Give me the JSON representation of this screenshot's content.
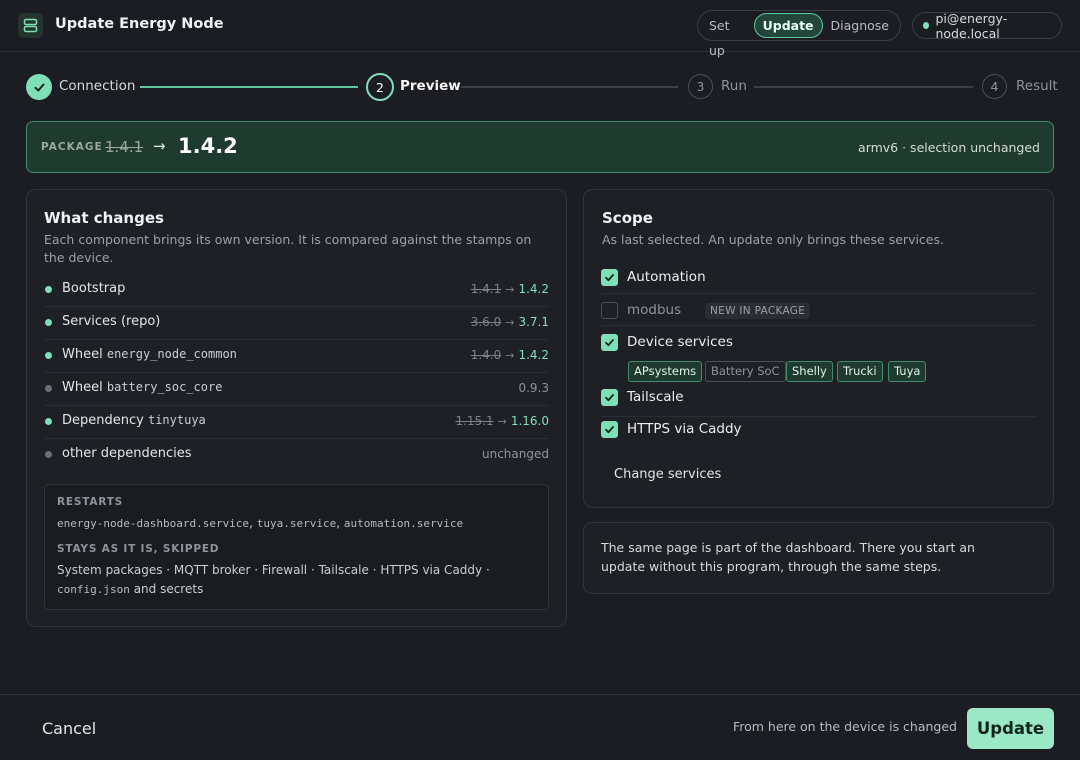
{
  "app": {
    "title": "Update Energy Node"
  },
  "modes": {
    "setup": "Set up",
    "update": "Update",
    "diagnose": "Diagnose"
  },
  "host": "pi@energy-node.local",
  "steps": [
    {
      "label": "Connection",
      "number": "1",
      "state": "done"
    },
    {
      "label": "Preview",
      "number": "2",
      "state": "current"
    },
    {
      "label": "Run",
      "number": "3",
      "state": "pending"
    },
    {
      "label": "Result",
      "number": "4",
      "state": "pending"
    }
  ],
  "package": {
    "label": "PACKAGE",
    "old_version": "1.4.1",
    "arrow": "→",
    "new_version": "1.4.2",
    "note": "armv6 · selection unchanged"
  },
  "changes": {
    "title": "What changes",
    "subtitle": "Each component brings its own version. It is compared against the stamps on the device.",
    "items": [
      {
        "label": "Bootstrap",
        "code": "",
        "old": "1.4.1",
        "new": "1.4.2",
        "status": "changed"
      },
      {
        "label": "Services (repo)",
        "code": "",
        "old": "3.6.0",
        "new": "3.7.1",
        "status": "changed"
      },
      {
        "label": "Wheel",
        "code": "energy_node_common",
        "old": "1.4.0",
        "new": "1.4.2",
        "status": "changed"
      },
      {
        "label": "Wheel",
        "code": "battery_soc_core",
        "old": "",
        "new": "0.9.3",
        "status": "same"
      },
      {
        "label": "Dependency",
        "code": "tinytuya",
        "old": "1.15.1",
        "new": "1.16.0",
        "status": "changed"
      },
      {
        "label": "other dependencies",
        "code": "",
        "old": "",
        "new": "unchanged",
        "status": "same"
      }
    ],
    "arrow": "→",
    "restarts_label": "RESTARTS",
    "restarts": [
      "energy-node-dashboard.service",
      "tuya.service",
      "automation.service"
    ],
    "restarts_separator": ",",
    "skipped_label": "STAYS AS IT IS, SKIPPED",
    "skipped_text": "System packages · MQTT broker · Firewall · Tailscale · HTTPS via Caddy ·",
    "skipped_code": "config.json",
    "skipped_tail": "and secrets"
  },
  "scope": {
    "title": "Scope",
    "subtitle": "As last selected. An update only brings these services.",
    "items": [
      {
        "label": "Automation",
        "checked": true
      },
      {
        "label": "modbus",
        "checked": false,
        "badge": "NEW IN PACKAGE"
      },
      {
        "label": "Device services",
        "checked": true
      },
      {
        "label": "Tailscale",
        "checked": true
      },
      {
        "label": "HTTPS via Caddy",
        "checked": true
      }
    ],
    "device_chips": [
      {
        "label": "APsystems",
        "on": true
      },
      {
        "label": "Battery SoC",
        "on": false
      },
      {
        "label": "Shelly",
        "on": true
      },
      {
        "label": "Trucki",
        "on": true
      },
      {
        "label": "Tuya",
        "on": true
      }
    ],
    "change_services": "Change services"
  },
  "info": {
    "text": "The same page is part of the dashboard. There you start an update without this program, through the same steps."
  },
  "footer": {
    "cancel": "Cancel",
    "note": "From here on the device is changed",
    "update": "Update"
  },
  "colors": {
    "accent": "#7fe0b8",
    "accent_dark": "#1f3a2e",
    "background": "#1b1d22"
  }
}
